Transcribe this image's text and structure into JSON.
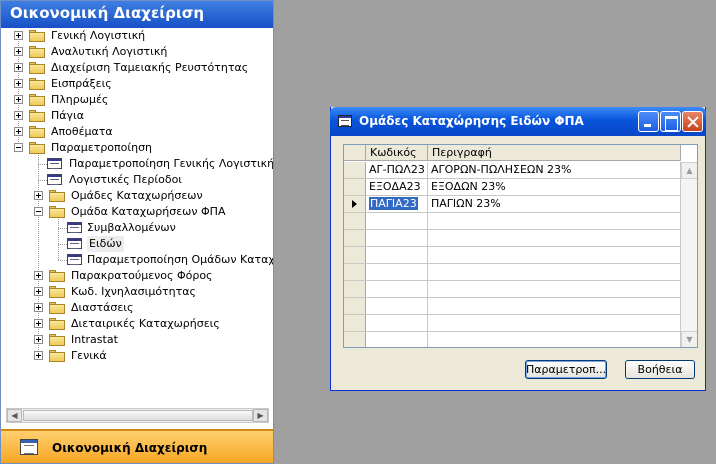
{
  "nav": {
    "title": "Οικονομική Διαχείριση",
    "bottom_label": "Οικονομική Διαχείριση",
    "items": [
      {
        "label": "Γενική Λογιστική",
        "kind": "folder",
        "toggle": "plus",
        "level": 0
      },
      {
        "label": "Αναλυτική Λογιστική",
        "kind": "folder",
        "toggle": "plus",
        "level": 0
      },
      {
        "label": "Διαχείριση Ταμειακής Ρευστότητας",
        "kind": "folder",
        "toggle": "plus",
        "level": 0
      },
      {
        "label": "Εισπράξεις",
        "kind": "folder",
        "toggle": "plus",
        "level": 0
      },
      {
        "label": "Πληρωμές",
        "kind": "folder",
        "toggle": "plus",
        "level": 0
      },
      {
        "label": "Πάγια",
        "kind": "folder",
        "toggle": "plus",
        "level": 0
      },
      {
        "label": "Αποθέματα",
        "kind": "folder",
        "toggle": "plus",
        "level": 0
      },
      {
        "label": "Παραμετροποίηση",
        "kind": "folder-open",
        "toggle": "minus",
        "level": 0
      },
      {
        "label": "Παραμετροποίηση Γενικής Λογιστικής",
        "kind": "form",
        "toggle": "none",
        "level": 1
      },
      {
        "label": "Λογιστικές Περίοδοι",
        "kind": "form",
        "toggle": "none",
        "level": 1
      },
      {
        "label": "Ομάδες Καταχωρήσεων",
        "kind": "folder",
        "toggle": "plus",
        "level": 1
      },
      {
        "label": "Ομάδα Καταχωρήσεων ΦΠΑ",
        "kind": "folder-open",
        "toggle": "minus",
        "level": 1
      },
      {
        "label": "Συμβαλλομένων",
        "kind": "form",
        "toggle": "none",
        "level": 2
      },
      {
        "label": "Ειδών",
        "kind": "form",
        "toggle": "none",
        "level": 2,
        "selected": true
      },
      {
        "label": "Παραμετροποίηση Ομάδων Καταχώρησ",
        "kind": "form",
        "toggle": "none",
        "level": 2
      },
      {
        "label": "Παρακρατούμενος Φόρος",
        "kind": "folder",
        "toggle": "plus",
        "level": 1
      },
      {
        "label": "Κωδ. Ιχνηλασιμότητας",
        "kind": "folder",
        "toggle": "plus",
        "level": 1
      },
      {
        "label": "Διαστάσεις",
        "kind": "folder",
        "toggle": "plus",
        "level": 1
      },
      {
        "label": "Διεταιρικές Καταχωρήσεις",
        "kind": "folder",
        "toggle": "plus",
        "level": 1
      },
      {
        "label": "Intrastat",
        "kind": "folder",
        "toggle": "plus",
        "level": 1
      },
      {
        "label": "Γενικά",
        "kind": "folder",
        "toggle": "plus",
        "level": 1
      }
    ]
  },
  "dialog": {
    "title": "Ομάδες Καταχώρησης Ειδών ΦΠΑ",
    "columns": [
      "Κωδικός",
      "Περιγραφή"
    ],
    "rows": [
      {
        "code": "ΑΓ-ΠΩΛ23",
        "description": "ΑΓΟΡΩΝ-ΠΩΛΗΣΕΩΝ 23%"
      },
      {
        "code": "ΕΞΟΔΑ23",
        "description": "ΕΞΟΔΩΝ 23%"
      },
      {
        "code": "ΠΑΓΙΑ23",
        "description": "ΠΑΓΙΩΝ 23%",
        "current": true
      }
    ],
    "empty_rows": 9,
    "buttons": {
      "params": "Παραμετροπ...",
      "help": "Βοήθεια"
    }
  },
  "icons": {
    "folder": "folder-icon",
    "form": "form-icon",
    "window": "form-icon",
    "row_pointer": "row-pointer-icon"
  }
}
